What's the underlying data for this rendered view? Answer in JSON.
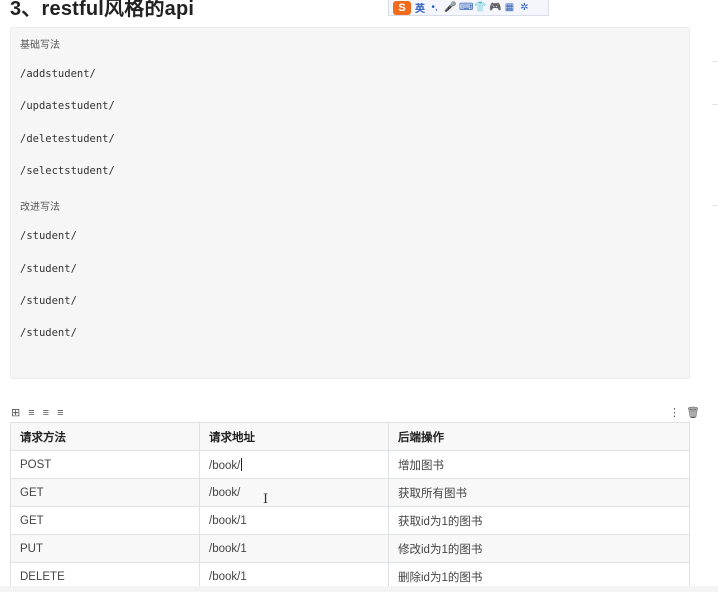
{
  "heading": "3、restful风格的api",
  "ime_toolbar": {
    "logo": "S",
    "lang": "英",
    "icons": [
      "punctuation-icon",
      "microphone-icon",
      "keyboard-icon",
      "skin-icon",
      "game-icon",
      "apps-icon",
      "settings-icon"
    ],
    "glyphs": [
      "•,",
      "🎤",
      "⌨",
      "👕",
      "🎮",
      "▦",
      "✲"
    ]
  },
  "code_block": {
    "lines": [
      {
        "text": "基础写法",
        "kind": "cn"
      },
      {
        "text": "/addstudent/",
        "kind": "code"
      },
      {
        "text": "/updatestudent/",
        "kind": "code"
      },
      {
        "text": "/deletestudent/",
        "kind": "code"
      },
      {
        "text": "/selectstudent/",
        "kind": "code"
      },
      {
        "text": "改进写法",
        "kind": "cn"
      },
      {
        "text": "/student/",
        "kind": "code"
      },
      {
        "text": "/student/",
        "kind": "code"
      },
      {
        "text": "/student/",
        "kind": "code"
      },
      {
        "text": "/student/",
        "kind": "code"
      }
    ]
  },
  "table_toolbar": {
    "left_icons": [
      "grid-icon",
      "align-left-icon",
      "align-center-icon",
      "align-right-icon"
    ],
    "left_glyphs": [
      "⊞",
      "≡",
      "≡",
      "≡"
    ],
    "right_icons": [
      "more-icon",
      "delete-icon"
    ],
    "right_glyphs": [
      "⋮",
      "🗑"
    ]
  },
  "table": {
    "headers": [
      "请求方法",
      "请求地址",
      "后端操作"
    ],
    "rows": [
      [
        "POST",
        "/book/",
        "增加图书"
      ],
      [
        "GET",
        "/book/",
        "获取所有图书"
      ],
      [
        "GET",
        "/book/1",
        "获取id为1的图书"
      ],
      [
        "PUT",
        "/book/1",
        "修改id为1的图书"
      ],
      [
        "DELETE",
        "/book/1",
        "删除id为1的图书"
      ]
    ]
  },
  "text_cursor_glyph": "I"
}
